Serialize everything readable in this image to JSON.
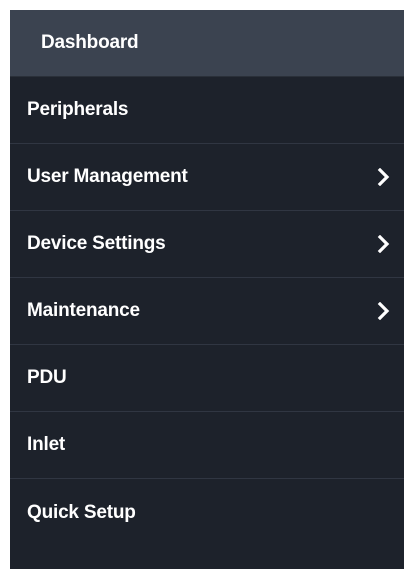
{
  "menu": {
    "items": [
      {
        "label": "Dashboard",
        "active": true,
        "has_submenu": false
      },
      {
        "label": "Peripherals",
        "active": false,
        "has_submenu": false
      },
      {
        "label": "User Management",
        "active": false,
        "has_submenu": true,
        "icon": "chevron-right-icon"
      },
      {
        "label": "Device Settings",
        "active": false,
        "has_submenu": true,
        "icon": "chevron-right-icon"
      },
      {
        "label": "Maintenance",
        "active": false,
        "has_submenu": true,
        "icon": "chevron-right-icon"
      },
      {
        "label": "PDU",
        "active": false,
        "has_submenu": false
      },
      {
        "label": "Inlet",
        "active": false,
        "has_submenu": false
      },
      {
        "label": "Quick Setup",
        "active": false,
        "has_submenu": false
      }
    ]
  },
  "colors": {
    "menu_bg": "#1d222b",
    "active_bg": "#3b4350",
    "divider": "#303642",
    "text": "#ffffff"
  }
}
